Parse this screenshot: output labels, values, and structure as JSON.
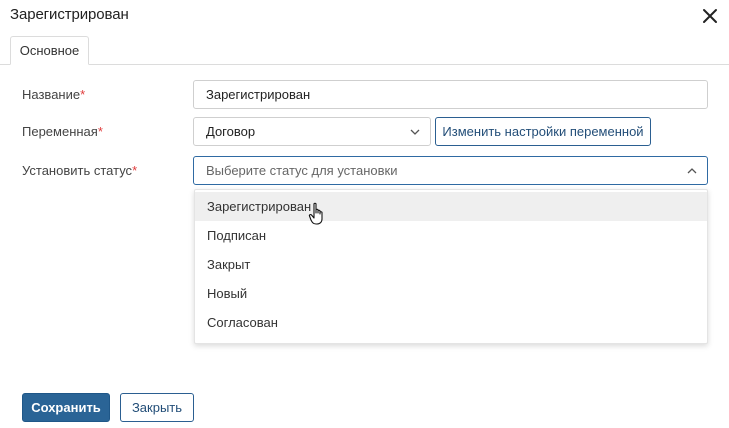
{
  "dialog": {
    "title": "Зарегистрирован",
    "close_icon": "close-icon"
  },
  "tabs": [
    {
      "label": "Основное",
      "active": true
    }
  ],
  "form": {
    "name": {
      "label": "Название",
      "required_mark": "*",
      "value": "Зарегистрирован"
    },
    "variable": {
      "label": "Переменная",
      "required_mark": "*",
      "value": "Договор",
      "settings_button": "Изменить настройки переменной"
    },
    "status": {
      "label": "Установить статус",
      "required_mark": "*",
      "placeholder": "Выберите статус для установки",
      "options": [
        "Зарегистрирован",
        "Подписан",
        "Закрыт",
        "Новый",
        "Согласован"
      ],
      "hovered_option": "Зарегистрирован"
    }
  },
  "footer": {
    "save_label": "Сохранить",
    "close_label": "Закрыть"
  },
  "colors": {
    "primary": "#2a6496",
    "required": "#e03b3b",
    "focus_border": "#2f6aa3"
  }
}
